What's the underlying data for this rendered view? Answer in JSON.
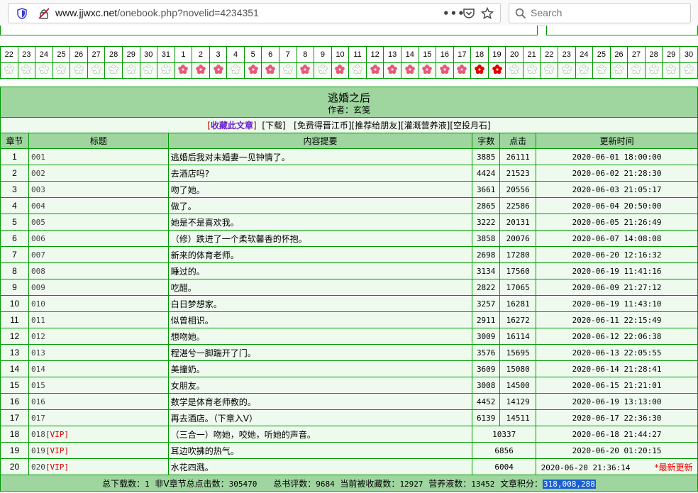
{
  "browser": {
    "url_host": "www.jjwxc.net",
    "url_path": "/onebook.php?novelid=4234351",
    "search_placeholder": "Search"
  },
  "calendar": {
    "days": [
      "22",
      "23",
      "24",
      "25",
      "26",
      "27",
      "28",
      "29",
      "30",
      "31",
      "1",
      "2",
      "3",
      "4",
      "5",
      "6",
      "7",
      "8",
      "9",
      "10",
      "11",
      "12",
      "13",
      "14",
      "15",
      "16",
      "17",
      "18",
      "19",
      "20",
      "21",
      "22",
      "23",
      "24",
      "25",
      "26",
      "27",
      "28",
      "29",
      "30"
    ],
    "marks": [
      "empty",
      "empty",
      "empty",
      "empty",
      "empty",
      "empty",
      "empty",
      "empty",
      "empty",
      "empty",
      "pink",
      "pink",
      "pink",
      "empty",
      "pink",
      "pink",
      "empty",
      "pink",
      "empty",
      "pink",
      "empty",
      "pink",
      "pink",
      "pink",
      "pink",
      "pink",
      "pink",
      "red",
      "red",
      "empty",
      "empty",
      "empty",
      "empty",
      "empty",
      "empty",
      "empty",
      "empty",
      "empty",
      "empty",
      "empty"
    ],
    "colors": {
      "pink": "#e85a7a",
      "red": "#e00000",
      "empty": "#c9d9c9"
    }
  },
  "book": {
    "title": "逃婚之后",
    "author": "作者：玄笺"
  },
  "links": {
    "favorite": "收藏此文章",
    "download": "下载",
    "free_coins": "免费得晋江币",
    "recommend": "推荐给朋友",
    "nutrient": "灌溉营养液",
    "moonstone": "空投月石"
  },
  "headers": {
    "chapter": "章节",
    "title": "标题",
    "summary": "内容提要",
    "words": "字数",
    "clicks": "点击",
    "updated": "更新时间"
  },
  "chapters": [
    {
      "n": "1",
      "t": "001",
      "vip": "",
      "s": "逃婚后我对未婚妻一见钟情了。",
      "w": "3885",
      "c": "26111",
      "d": "2020-06-01 18:00:00"
    },
    {
      "n": "2",
      "t": "002",
      "vip": "",
      "s": "去酒店吗?",
      "w": "4424",
      "c": "21523",
      "d": "2020-06-02 21:28:30"
    },
    {
      "n": "3",
      "t": "003",
      "vip": "",
      "s": "吻了她。",
      "w": "3661",
      "c": "20556",
      "d": "2020-06-03 21:05:17"
    },
    {
      "n": "4",
      "t": "004",
      "vip": "",
      "s": "做了。",
      "w": "2865",
      "c": "22586",
      "d": "2020-06-04 20:50:00"
    },
    {
      "n": "5",
      "t": "005",
      "vip": "",
      "s": "她是不是喜欢我。",
      "w": "3222",
      "c": "20131",
      "d": "2020-06-05 21:26:49"
    },
    {
      "n": "6",
      "t": "006",
      "vip": "",
      "s": "（修）跌进了一个柔软馨香的怀抱。",
      "w": "3858",
      "c": "20076",
      "d": "2020-06-07 14:08:08"
    },
    {
      "n": "7",
      "t": "007",
      "vip": "",
      "s": "新来的体育老师。",
      "w": "2698",
      "c": "17280",
      "d": "2020-06-20 12:16:32"
    },
    {
      "n": "8",
      "t": "008",
      "vip": "",
      "s": "睡过的。",
      "w": "3134",
      "c": "17560",
      "d": "2020-06-19 11:41:16"
    },
    {
      "n": "9",
      "t": "009",
      "vip": "",
      "s": "吃醋。",
      "w": "2822",
      "c": "17065",
      "d": "2020-06-09 21:27:12"
    },
    {
      "n": "10",
      "t": "010",
      "vip": "",
      "s": "白日梦想家。",
      "w": "3257",
      "c": "16281",
      "d": "2020-06-19 11:43:10"
    },
    {
      "n": "11",
      "t": "011",
      "vip": "",
      "s": "似曾相识。",
      "w": "2911",
      "c": "16272",
      "d": "2020-06-11 22:15:49"
    },
    {
      "n": "12",
      "t": "012",
      "vip": "",
      "s": "想吻她。",
      "w": "3009",
      "c": "16114",
      "d": "2020-06-12 22:06:38"
    },
    {
      "n": "13",
      "t": "013",
      "vip": "",
      "s": "程湛兮一脚踹开了门。",
      "w": "3576",
      "c": "15695",
      "d": "2020-06-13 22:05:55"
    },
    {
      "n": "14",
      "t": "014",
      "vip": "",
      "s": "美撞奶。",
      "w": "3609",
      "c": "15080",
      "d": "2020-06-14 21:28:41"
    },
    {
      "n": "15",
      "t": "015",
      "vip": "",
      "s": "女朋友。",
      "w": "3008",
      "c": "14500",
      "d": "2020-06-15 21:21:01"
    },
    {
      "n": "16",
      "t": "016",
      "vip": "",
      "s": "数学是体育老师教的。",
      "w": "4452",
      "c": "14129",
      "d": "2020-06-19 13:13:00"
    },
    {
      "n": "17",
      "t": "017",
      "vip": "",
      "s": "再去酒店。（下章入V）",
      "w": "6139",
      "c": "14511",
      "d": "2020-06-17 22:36:30"
    },
    {
      "n": "18",
      "t": "018",
      "vip": "[VIP]",
      "s": "（三合一）吻她，咬她，听她的声音。",
      "w": "10337",
      "c": "",
      "d": "2020-06-18 21:44:27"
    },
    {
      "n": "19",
      "t": "019",
      "vip": "[VIP]",
      "s": "耳边吹拂的热气。",
      "w": "6856",
      "c": "",
      "d": "2020-06-20 01:20:15"
    },
    {
      "n": "20",
      "t": "020",
      "vip": "[VIP]",
      "s": "水花四溅。",
      "w": "6004",
      "c": "",
      "d": "2020-06-20 21:36:14"
    }
  ],
  "latest_tag": "*最新更新",
  "footer": {
    "downloads_label": "总下载数：",
    "downloads": "1",
    "nonv_label": "非V章节总点击数：",
    "nonv": "305470",
    "reviews_label": "总书评数：",
    "reviews": "9684",
    "favorites_label": "当前被收藏数：",
    "favorites": "12927",
    "nutrient_label": "营养液数：",
    "nutrient": "13452",
    "score_label": "文章积分：",
    "score": "318,008,288"
  }
}
